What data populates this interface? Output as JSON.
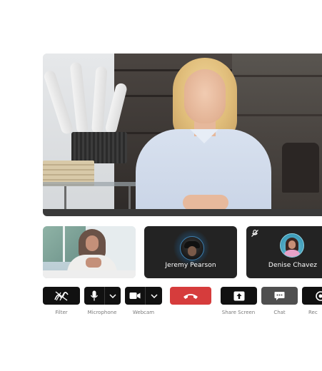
{
  "participants": [
    {
      "name": "Jeremy Pearson",
      "speaking": true,
      "muted": false
    },
    {
      "name": "Denise Chavez",
      "speaking": false,
      "muted": true
    }
  ],
  "controls": {
    "filter_label": "Filter",
    "microphone_label": "Microphone",
    "webcam_label": "Webcam",
    "share_screen_label": "Share Screen",
    "chat_label": "Chat",
    "record_label": "Rec"
  },
  "colors": {
    "end_call": "#d63c3c",
    "control_bg": "#111111",
    "chat_active_bg": "#4f4f4f",
    "tile_bg": "#232323",
    "speaking_ring": "#3d7fb0"
  },
  "icons": {
    "filter": "filter-icon",
    "microphone": "microphone-icon",
    "webcam": "webcam-icon",
    "end_call": "phone-hangup-icon",
    "share_screen": "share-screen-icon",
    "chat": "chat-bubble-icon",
    "record": "record-icon",
    "muted": "microphone-muted-icon"
  }
}
